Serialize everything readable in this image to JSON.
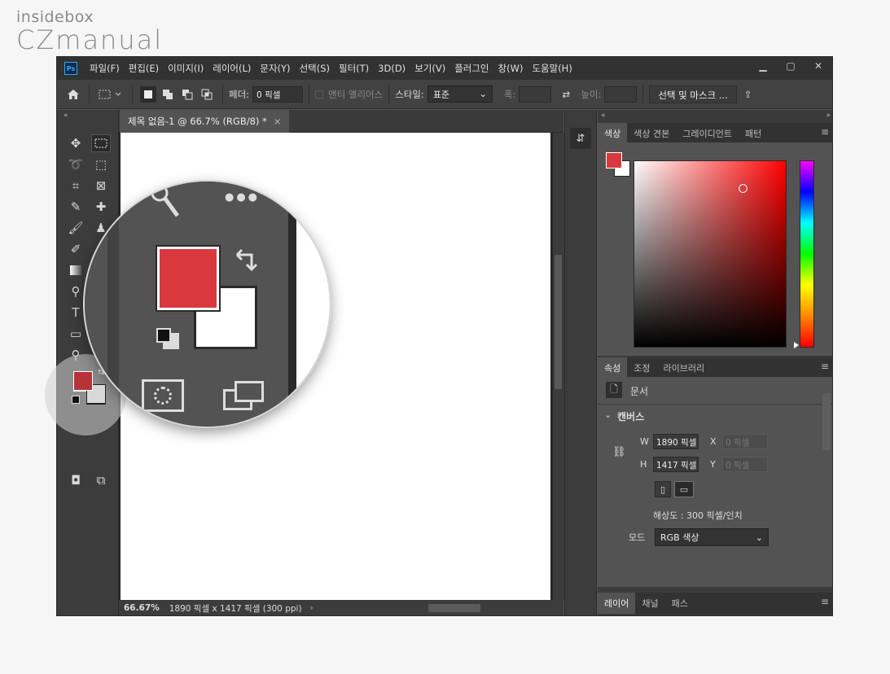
{
  "watermark": {
    "line1": "insidebox",
    "line2": "CZmanual"
  },
  "menubar": {
    "app_icon": "Ps",
    "items": [
      "파일(F)",
      "편집(E)",
      "이미지(I)",
      "레이어(L)",
      "문자(Y)",
      "선택(S)",
      "필터(T)",
      "3D(D)",
      "보기(V)",
      "플러그인",
      "창(W)",
      "도움말(H)"
    ]
  },
  "options": {
    "feather_label": "페더:",
    "feather_value": "0 픽셀",
    "antialias_label": "앤티 앨리어스",
    "style_label": "스타일:",
    "style_value": "표준",
    "width_label": "폭:",
    "height_label": "높이:",
    "select_mask_button": "선택 및 마스크 ..."
  },
  "document": {
    "tab_title": "제목 없음-1 @ 66.7% (RGB/8) *",
    "close": "×",
    "zoom": "66.67%",
    "doc_info": "1890 픽셀 x 1417 픽셀 (300 ppi)"
  },
  "color_panel": {
    "tabs": [
      "색상",
      "색상 견본",
      "그레이디언트",
      "패턴"
    ],
    "foreground_color": "#d9383e",
    "background_color": "#ffffff"
  },
  "properties_panel": {
    "tabs": [
      "속성",
      "조정",
      "라이브러리"
    ],
    "doc_label": "문서",
    "section": "캔버스",
    "w_label": "W",
    "w_value": "1890 픽셀",
    "h_label": "H",
    "h_value": "1417 픽셀",
    "x_label": "X",
    "x_value": "0 픽셀",
    "y_label": "Y",
    "y_value": "0 픽셀",
    "resolution": "해상도 : 300 픽셀/인치",
    "mode_label": "모드",
    "mode_value": "RGB 색상"
  },
  "layers_panel": {
    "tabs": [
      "레이어",
      "채널",
      "패스"
    ]
  }
}
